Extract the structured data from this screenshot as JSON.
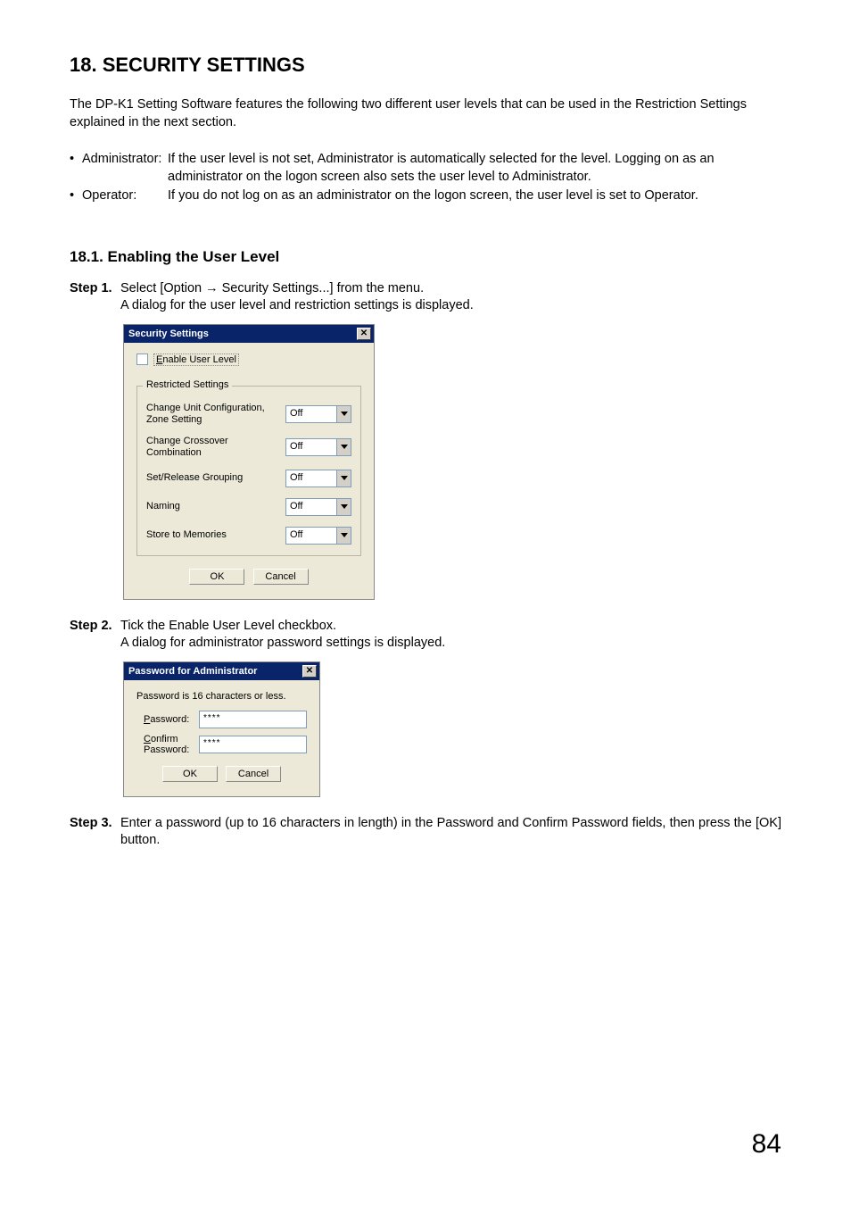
{
  "page_number": "84",
  "heading": "18. SECURITY SETTINGS",
  "intro": "The DP-K1 Setting Software features the following two different user levels that can be used in the Restriction Settings explained in the next section.",
  "levels": [
    {
      "bullet": "•",
      "term": "Administrator:",
      "def": "If the user level is not set, Administrator is automatically selected for the level. Logging on as an administrator on the logon screen also sets the user level to Administrator."
    },
    {
      "bullet": "•",
      "term": "Operator:",
      "def": "If you do not log on as an administrator on the logon screen, the user level is set to Operator."
    }
  ],
  "subheading": "18.1. Enabling the User Level",
  "steps": {
    "s1_label": "Step 1.",
    "s1_line1": "Select [Option  →  Security Settings...] from the menu.",
    "s1_line2": "A dialog for the user level and restriction settings is displayed.",
    "s2_label": "Step 2.",
    "s2_line1": "Tick the Enable User Level checkbox.",
    "s2_line2": "A dialog for administrator password settings is displayed.",
    "s3_label": "Step 3.",
    "s3_line1": "Enter a password (up to 16 characters in length) in the Password and Confirm Password fields, then press the [OK] button."
  },
  "dialog1": {
    "title": "Security Settings",
    "checkbox_label": "Enable User Level",
    "group_label": "Restricted Settings",
    "rows": [
      {
        "label": "Change Unit Configuration, Zone Setting",
        "value": "Off"
      },
      {
        "label": "Change Crossover Combination",
        "value": "Off"
      },
      {
        "label": "Set/Release Grouping",
        "value": "Off"
      },
      {
        "label": "Naming",
        "value": "Off"
      },
      {
        "label": "Store to Memories",
        "value": "Off"
      }
    ],
    "ok": "OK",
    "cancel": "Cancel"
  },
  "dialog2": {
    "title": "Password for Administrator",
    "hint": "Password is 16 characters or less.",
    "pw_label": "Password:",
    "confirm_label": "Confirm Password:",
    "pw_value": "****",
    "confirm_value": "****",
    "ok": "OK",
    "cancel": "Cancel"
  }
}
